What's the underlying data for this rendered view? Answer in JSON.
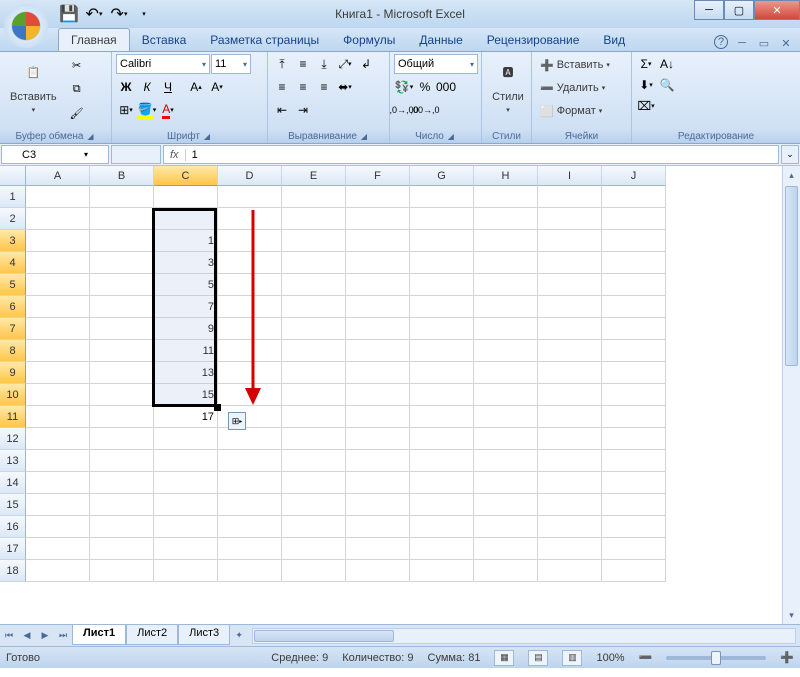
{
  "app": {
    "title": "Книга1 - Microsoft Excel"
  },
  "qat": {
    "save_tip": "💾",
    "undo_tip": "↶",
    "redo_tip": "↷"
  },
  "tabs": [
    "Главная",
    "Вставка",
    "Разметка страницы",
    "Формулы",
    "Данные",
    "Рецензирование",
    "Вид"
  ],
  "active_tab": 0,
  "ribbon": {
    "clipboard": {
      "paste": "Вставить",
      "label": "Буфер обмена"
    },
    "font": {
      "name": "Calibri",
      "size": "11",
      "label": "Шрифт",
      "bold": "Ж",
      "italic": "К",
      "underline": "Ч"
    },
    "align": {
      "label": "Выравнивание"
    },
    "number": {
      "format": "Общий",
      "label": "Число"
    },
    "styles": {
      "label": "Стили",
      "btn": "Стили"
    },
    "cells": {
      "insert": "Вставить",
      "delete": "Удалить",
      "format": "Формат",
      "label": "Ячейки"
    },
    "editing": {
      "label": "Редактирование"
    }
  },
  "namebox": "C3",
  "formula": "1",
  "columns": [
    "A",
    "B",
    "C",
    "D",
    "E",
    "F",
    "G",
    "H",
    "I",
    "J"
  ],
  "sel_col_index": 2,
  "rows": 18,
  "sel_rows_from": 3,
  "sel_rows_to": 11,
  "cell_data": {
    "C3": "1",
    "C4": "3",
    "C5": "5",
    "C6": "7",
    "C7": "9",
    "C8": "11",
    "C9": "13",
    "C10": "15",
    "C11": "17"
  },
  "sheets": [
    "Лист1",
    "Лист2",
    "Лист3"
  ],
  "active_sheet": 0,
  "status": {
    "ready": "Готово",
    "avg_label": "Среднее:",
    "avg": "9",
    "count_label": "Количество:",
    "count": "9",
    "sum_label": "Сумма:",
    "sum": "81",
    "zoom": "100%"
  }
}
